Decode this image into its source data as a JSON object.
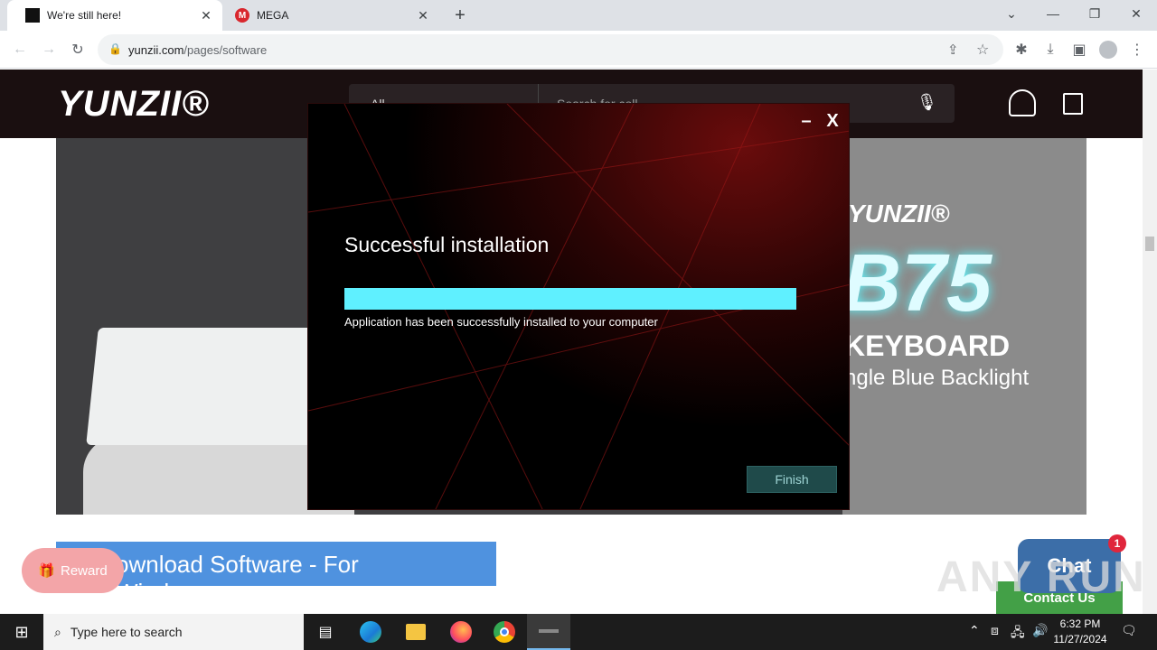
{
  "browser": {
    "tabs": [
      {
        "title": "We're still here!",
        "active": true
      },
      {
        "title": "MEGA",
        "active": false
      }
    ],
    "url_host": "yunzii.com",
    "url_path": "/pages/software"
  },
  "site": {
    "logo": "YUNZII®",
    "search_category": "All",
    "search_placeholder": "Search for coll..."
  },
  "banner": {
    "brand": "YUNZII®",
    "model": "B75",
    "keyboard_label": "KEYBOARD",
    "backlight": "ngle Blue Backlight"
  },
  "download_button": "ownload Software - For Windows",
  "reward_label": "Reward",
  "chat_label": "Chat",
  "chat_badge": "1",
  "contact_label": "Contact Us",
  "installer": {
    "title": "Successful installation",
    "message": "Application has been successfully installed to your computer",
    "progress": 1.0,
    "progress_color": "#5ff0ff",
    "finish_label": "Finish",
    "minimize": "–",
    "close": "X"
  },
  "taskbar": {
    "search_placeholder": "Type here to search",
    "time": "6:32 PM",
    "date": "11/27/2024"
  },
  "watermark": "ANY RUN"
}
